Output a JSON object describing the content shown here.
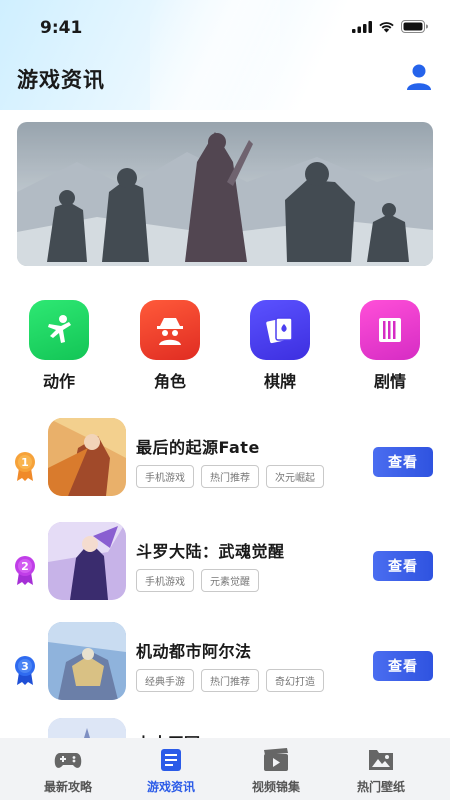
{
  "status_bar": {
    "time": "9:41"
  },
  "header": {
    "title": "游戏资讯"
  },
  "categories": [
    {
      "label": "动作",
      "icon": "kick-icon",
      "color": "#1fd15e"
    },
    {
      "label": "角色",
      "icon": "spy-icon",
      "color": "#ee3f2c"
    },
    {
      "label": "棋牌",
      "icon": "cards-icon",
      "color": "#4b3ff0"
    },
    {
      "label": "剧情",
      "icon": "book-icon",
      "color": "#e43bd0"
    }
  ],
  "games": [
    {
      "rank": "1",
      "name": "最后的起源Fate",
      "tags": [
        "手机游戏",
        "热门推荐",
        "次元崛起"
      ],
      "button": "查看"
    },
    {
      "rank": "2",
      "name": "斗罗大陆：武魂觉醒",
      "tags": [
        "手机游戏",
        "元素觉醒"
      ],
      "button": "查看"
    },
    {
      "rank": "3",
      "name": "机动都市阿尔法",
      "tags": [
        "经典手游",
        "热门推荐",
        "奇幻打造"
      ],
      "button": "查看"
    }
  ],
  "partial_item": {
    "name": "上古王冠"
  },
  "tabbar": [
    {
      "label": "最新攻略",
      "icon": "gamepad-icon"
    },
    {
      "label": "游戏资讯",
      "icon": "news-icon",
      "active": true
    },
    {
      "label": "视频锦集",
      "icon": "video-icon"
    },
    {
      "label": "热门壁纸",
      "icon": "wallpaper-icon"
    }
  ]
}
